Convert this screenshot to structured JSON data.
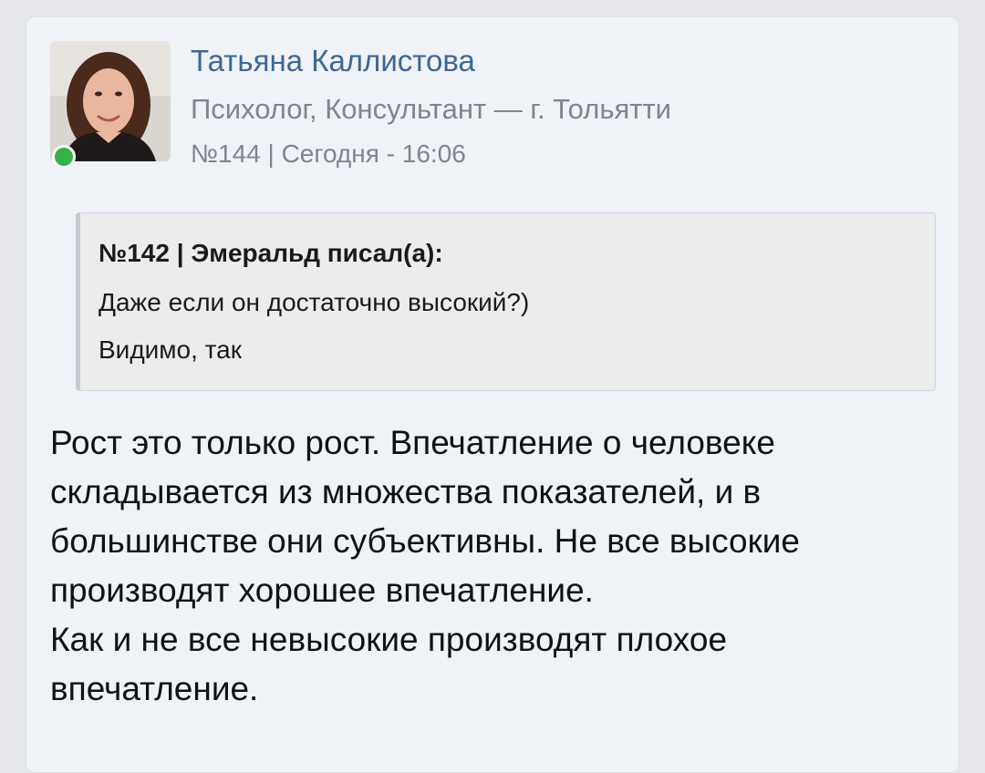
{
  "post": {
    "author": {
      "name": "Татьяна Каллистова",
      "subtitle": "Психолог, Консультант — г. Тольятти",
      "online": true
    },
    "meta": "№144 | Сегодня - 16:06",
    "quote": {
      "header": "№142 | Эмеральд писал(а):",
      "lines": [
        "Даже если он достаточно высокий?)",
        "Видимо, так"
      ]
    },
    "body": [
      "Рост это только рост. Впечатление о человеке складывается из множества показателей, и в большинстве они субъективны. Не все высокие производят хорошее впечатление.",
      "Как и не все невысокие производят плохое впечатление."
    ]
  },
  "colors": {
    "author_link": "#3d6796",
    "muted": "#7e858c",
    "online": "#35b34a",
    "card_bg": "#eff2f6",
    "quote_bg": "#ececec"
  }
}
